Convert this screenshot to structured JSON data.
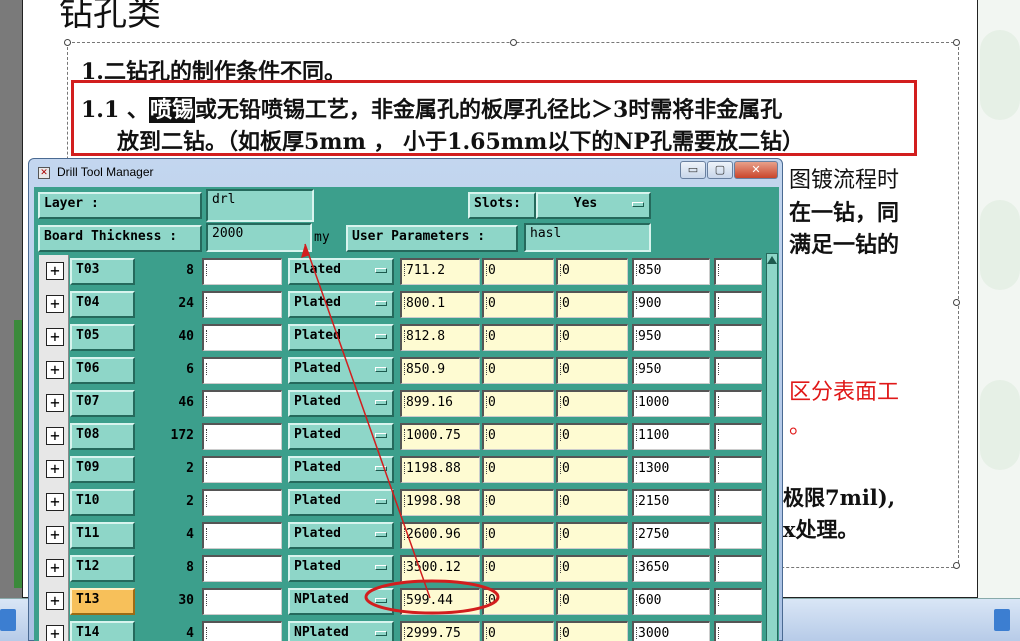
{
  "slide": {
    "title": "钻孔类",
    "heading": "1.二钻孔的制作条件不同。",
    "p1_prefix": "1.1 、",
    "p1_highlight": "喷锡",
    "p1_rest": "或无铅喷锡工艺，非金属孔的板厚孔径比＞3时需将非金属孔",
    "p1_line2": "放到二钻。（如板厚5mm ， 小于1.65mm以下的NP孔需要放二钻）",
    "right_lines": [
      "图镀流程时",
      "在一钻，同",
      "满足一钻的"
    ],
    "red_lines": [
      "区分表面工",
      "。"
    ],
    "tail_lines": [
      "极限7mil),",
      "x处理。"
    ]
  },
  "window": {
    "title": "Drill Tool Manager",
    "min_label": "▭",
    "max_label": "▢",
    "close_label": "✕"
  },
  "header": {
    "layer_label": "Layer          :",
    "layer_value": "drl",
    "slots_label": "Slots:",
    "slots_value": "Yes",
    "board_label": "Board Thickness :",
    "board_value": "2000",
    "board_unit": "my",
    "userparam_label": "User Parameters :",
    "userparam_value": "hasl"
  },
  "tools": [
    {
      "name": "T03",
      "qty": "8",
      "type": "Plated",
      "size": "711.2",
      "c1": "0",
      "c2": "0",
      "finish": "850",
      "active": false
    },
    {
      "name": "T04",
      "qty": "24",
      "type": "Plated",
      "size": "800.1",
      "c1": "0",
      "c2": "0",
      "finish": "900",
      "active": false
    },
    {
      "name": "T05",
      "qty": "40",
      "type": "Plated",
      "size": "812.8",
      "c1": "0",
      "c2": "0",
      "finish": "950",
      "active": false
    },
    {
      "name": "T06",
      "qty": "6",
      "type": "Plated",
      "size": "850.9",
      "c1": "0",
      "c2": "0",
      "finish": "950",
      "active": false
    },
    {
      "name": "T07",
      "qty": "46",
      "type": "Plated",
      "size": "899.16",
      "c1": "0",
      "c2": "0",
      "finish": "1000",
      "active": false
    },
    {
      "name": "T08",
      "qty": "172",
      "type": "Plated",
      "size": "1000.75",
      "c1": "0",
      "c2": "0",
      "finish": "1100",
      "active": false
    },
    {
      "name": "T09",
      "qty": "2",
      "type": "Plated",
      "size": "1198.88",
      "c1": "0",
      "c2": "0",
      "finish": "1300",
      "active": false
    },
    {
      "name": "T10",
      "qty": "2",
      "type": "Plated",
      "size": "1998.98",
      "c1": "0",
      "c2": "0",
      "finish": "2150",
      "active": false
    },
    {
      "name": "T11",
      "qty": "4",
      "type": "Plated",
      "size": "2600.96",
      "c1": "0",
      "c2": "0",
      "finish": "2750",
      "active": false
    },
    {
      "name": "T12",
      "qty": "8",
      "type": "Plated",
      "size": "3500.12",
      "c1": "0",
      "c2": "0",
      "finish": "3650",
      "active": false
    },
    {
      "name": "T13",
      "qty": "30",
      "type": "NPlated",
      "size": "599.44",
      "c1": "0",
      "c2": "0",
      "finish": "600",
      "active": true
    },
    {
      "name": "T14",
      "qty": "4",
      "type": "NPlated",
      "size": "2999.75",
      "c1": "0",
      "c2": "0",
      "finish": "3000",
      "active": false
    }
  ],
  "colors": {
    "panel_teal": "#3c9f8c",
    "button_teal": "#8ed6c8",
    "active_tool": "#f7c05a",
    "annotation_red": "#d21e1e"
  }
}
